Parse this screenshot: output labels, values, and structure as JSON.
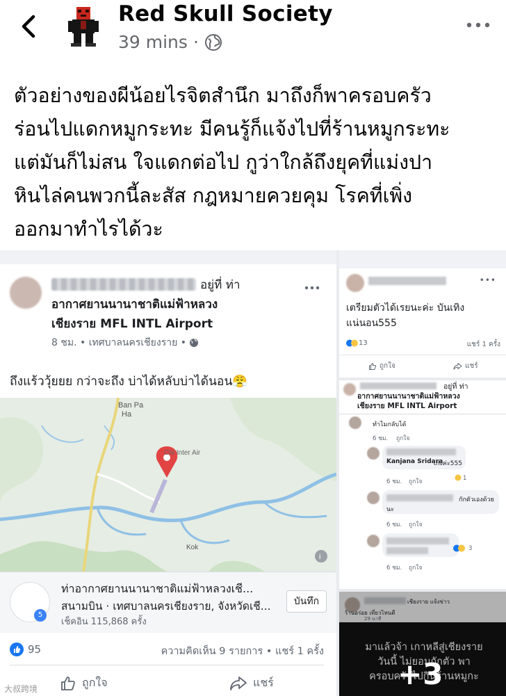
{
  "header": {
    "page_name": "Red Skull Society",
    "time": "39 mins",
    "separator": "·",
    "privacy_icon": "globe-icon",
    "back_icon": "chevron-left-icon",
    "more_icon": "more-horizontal-icon"
  },
  "post": {
    "lines": [
      "ตัวอย่างของผีน้อยไรจิตสำนึก มาถึงก็พาครอบครัว",
      "ร่อนไปแดกหมูกระทะ มีคนรู้ก็แจ้งไปที่ร้านหมูกระทะ",
      "แต่มันก็ไม่สน ใจแดกต่อไป กูว่าใกล้ถึงยุคที่แม่งปา",
      "หินไล่คนพวกนี้ละสัส กฎหมายควยคุม โรคที่เพิ่ง",
      "ออกมาทำไรได้วะ"
    ]
  },
  "gallery": {
    "main": {
      "at_text": "อยู่ที่ ท่า",
      "location_line1": "อากาศยานนานาชาติแม่ฟ้าหลวง",
      "location_line2": "เชียงราย MFL INTL Airport",
      "sub": "8 ชม. • เทศบาลนครเชียงราย •",
      "body": "ถึงแร้ววุ้ยยย กว่าจะถึง บ่าได้หลับบ่าได้นอน😤",
      "map_labels": {
        "ban_pa_1": "Ban Pa",
        "ban_pa_2": "Ha",
        "airport": "Chi Inter Air",
        "kok": "Kok"
      },
      "place": {
        "name": "ท่าอากาศยานนานาชาติแม่ฟ้าหลวงเชี...",
        "category": "สนามบิน · เทศบาลนครเชียงราย, จังหวัดเชี...",
        "checkins": "เช็คอิน 115,868 ครั้ง",
        "save_label": "บันทึก",
        "logo_badge": "5"
      },
      "reactions_count": "95",
      "comments_shares": "ความคิดเห็น 9 รายการ • แชร์ 1 ครั้ง",
      "like_label": "ถูกใจ",
      "share_label": "แชร์"
    },
    "right_top": {
      "text": "เตรียมตัวได้เรยนะค่ะ บันเทิงแน่นอน555",
      "reactions_count": "13",
      "shares": "แชร์ 1 ครั้ง",
      "like_label": "ถูกใจ",
      "share_label": "แชร์"
    },
    "right_mid": {
      "header_at": "อยู่ที่ ท่า",
      "header_line1": "อากาศยานนานาชาติแม่ฟ้าหลวง",
      "header_line2": "เชียงราย MFL INTL Airport",
      "c1_text": "ทำไมกลับได้",
      "c1_time": "6 ชม.",
      "c1_like": "ถูกใจ",
      "c2_name": "Kanjana Sridara",
      "c2_text": "เก่งค่ะ555",
      "c2_time": "6 ชม.",
      "c2_like": "ถูกใจ",
      "c2_react": "1",
      "c3_text": "กักตัวเองด้วย",
      "c3_text2": "นะ",
      "c3_time": "6 ชม.",
      "c3_like": "ถูกใจ",
      "c4_react": "3",
      "c4_time": "6 ชม.",
      "c4_like": "ถูกใจ"
    },
    "right_bottom": {
      "header_name": "ร้านอร่อย เที่ยวไหนดี",
      "header_right": "เชียงราย แจ้งข่าว",
      "header_date": "29 นาที",
      "text_line1": "มาแล้วจ้า เกาหลีสู่เชียงราย",
      "text_line2": "วันนี้ ไม่ยอมกักตัว พา",
      "text_line3": "ครอบครัวไปกินร้านหมูกะ",
      "more_count": "+3"
    }
  },
  "watermark": "大叔跨境"
}
